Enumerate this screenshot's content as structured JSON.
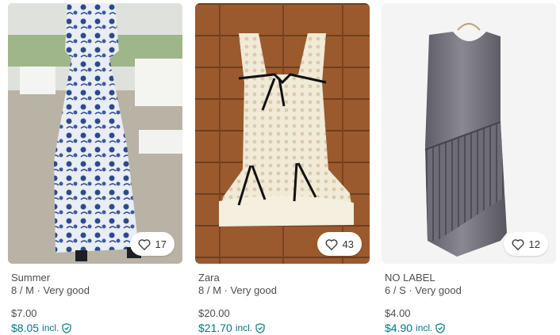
{
  "colors": {
    "accent": "#007782",
    "muted": "#4d4d4d"
  },
  "items": [
    {
      "brand": "Summer",
      "details": "8 / M · Very good",
      "price": "$7.00",
      "total": "$8.05",
      "incl": "incl.",
      "favorites": "17",
      "image": "blue-floral-maxi-dress",
      "icons": {
        "favorite": "heart-icon",
        "protection": "shield-check-icon"
      }
    },
    {
      "brand": "Zara",
      "details": "8 / M · Very good",
      "price": "$20.00",
      "total": "$21.70",
      "incl": "incl.",
      "favorites": "43",
      "image": "white-lace-mini-dress",
      "icons": {
        "favorite": "heart-icon",
        "protection": "shield-check-icon"
      }
    },
    {
      "brand": "NO LABEL",
      "details": "6 / S · Very good",
      "price": "$4.00",
      "total": "$4.90",
      "incl": "incl.",
      "favorites": "12",
      "image": "grey-satin-pleated-dress",
      "icons": {
        "favorite": "heart-icon",
        "protection": "shield-check-icon"
      }
    }
  ]
}
